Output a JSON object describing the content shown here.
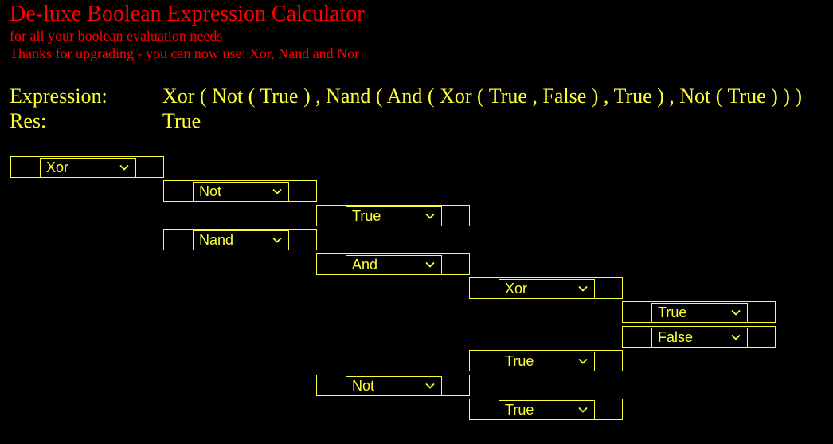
{
  "header": {
    "title": "De-luxe Boolean Expression Calculator",
    "subtitle": "for all your boolean evaluation needs",
    "upgrade_note": "Thanks for upgrading - you can now use: Xor, Nand and Nor"
  },
  "colors": {
    "background": "#000000",
    "header_text": "#ff0000",
    "expression_text": "#ffff33"
  },
  "expression": {
    "label": "Expression:",
    "value": "Xor ( Not ( True ) , Nand ( And ( Xor ( True , False ) , True ) , Not ( True ) ) )"
  },
  "result": {
    "label": "Res:",
    "value": "True"
  },
  "tree": [
    {
      "value": "Xor",
      "depth": 0
    },
    {
      "value": "Not",
      "depth": 1
    },
    {
      "value": "True",
      "depth": 2
    },
    {
      "value": "Nand",
      "depth": 1
    },
    {
      "value": "And",
      "depth": 2
    },
    {
      "value": "Xor",
      "depth": 3
    },
    {
      "value": "True",
      "depth": 4
    },
    {
      "value": "False",
      "depth": 4
    },
    {
      "value": "True",
      "depth": 3
    },
    {
      "value": "Not",
      "depth": 2
    },
    {
      "value": "True",
      "depth": 3
    }
  ],
  "icons": {
    "dropdown": "chevron-down-icon"
  }
}
